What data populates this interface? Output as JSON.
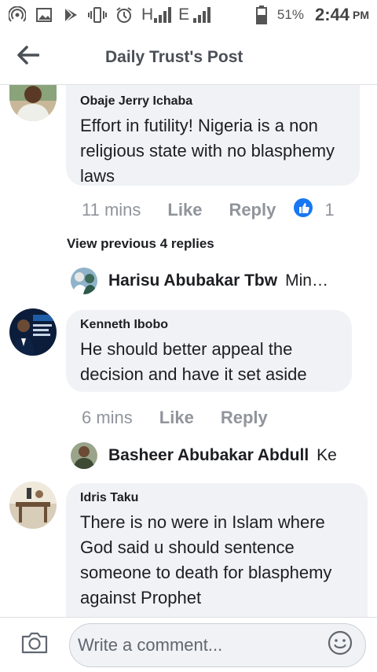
{
  "status_bar": {
    "network_h1": "H",
    "network_e": "E",
    "battery_pct": "51%",
    "time": "2:44",
    "ampm": "PM",
    "icons": [
      "hotspot-icon",
      "image-icon",
      "play-store-icon",
      "vibrate-icon",
      "alarm-icon",
      "signal-icon",
      "signal-icon",
      "battery-icon"
    ]
  },
  "header": {
    "title": "Daily Trust's Post",
    "back_icon": "back-arrow-icon"
  },
  "comments": [
    {
      "author": "Obaje Jerry Ichaba",
      "text": "Effort in futility! Nigeria is a non religious state with no blasphemy laws",
      "time": "11 mins",
      "like_label": "Like",
      "reply_label": "Reply",
      "like_count": "1"
    },
    {
      "author": "Kenneth Ibobo",
      "text": "He should better appeal the decision and have it set aside",
      "time": "6 mins",
      "like_label": "Like",
      "reply_label": "Reply"
    },
    {
      "author": "Idris Taku",
      "text": "There is no were in Islam where God said u should sentence someone to death for blasphemy against Prophet"
    }
  ],
  "view_previous": "View previous 4 replies",
  "reply_previews": [
    {
      "name": "Harisu Abubakar Tbw",
      "preview": "Min…"
    },
    {
      "name": "Basheer Abubakar Abdull",
      "preview": "Ke"
    }
  ],
  "composer": {
    "placeholder": "Write a comment...",
    "camera_icon": "camera-icon",
    "emoji_icon": "emoji-icon"
  },
  "colors": {
    "bubble_bg": "#f0f2f5",
    "meta_text": "#90949c",
    "like_blue": "#1877f2"
  }
}
